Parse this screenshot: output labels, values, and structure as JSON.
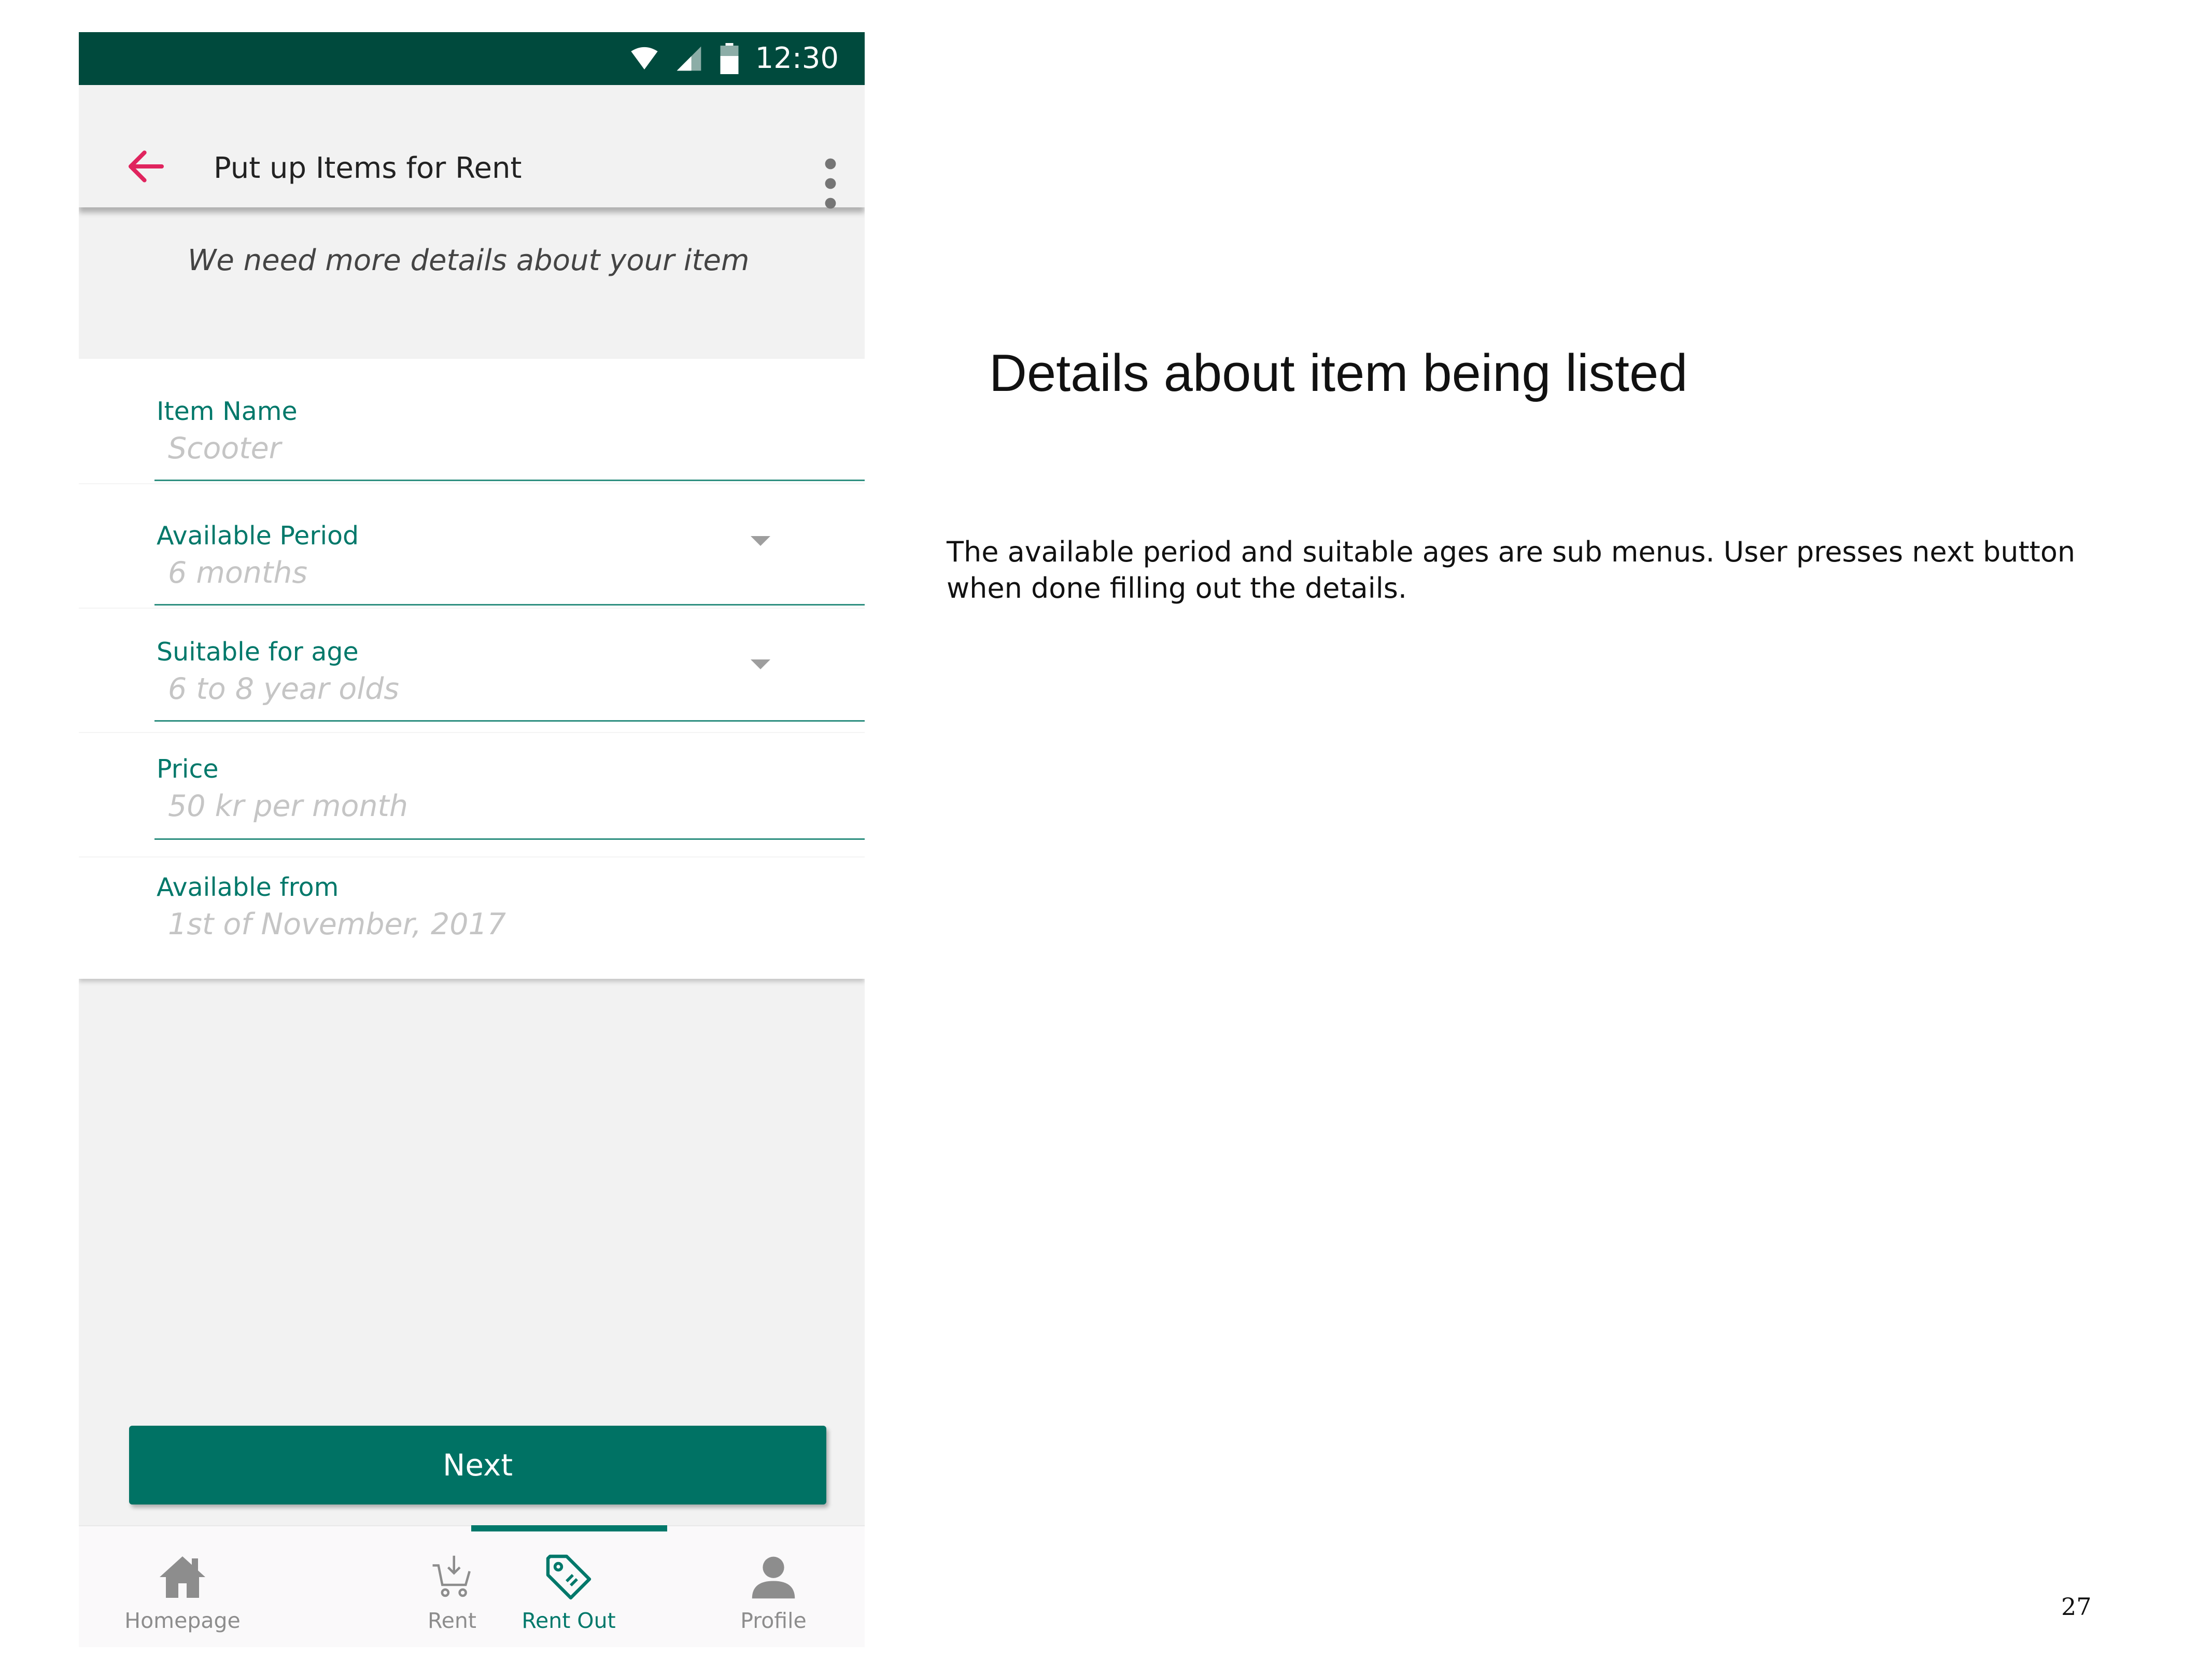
{
  "status_bar": {
    "time": "12:30",
    "icons": [
      "wifi-icon",
      "signal-icon",
      "battery-icon"
    ]
  },
  "app_bar": {
    "title": "Put up Items for Rent",
    "back_icon": "arrow-left-icon",
    "menu_icon": "more-vert-icon"
  },
  "subheader": {
    "message": "We need more details about your item"
  },
  "form": {
    "item_name": {
      "label": "Item Name",
      "placeholder": "Scooter"
    },
    "available_period": {
      "label": "Available Period",
      "placeholder": "6 months"
    },
    "suitable_age": {
      "label": "Suitable for age",
      "placeholder": "6 to 8 year olds"
    },
    "price": {
      "label": "Price",
      "placeholder": "50 kr per month"
    },
    "available_from": {
      "label": "Available from",
      "placeholder": "1st of November, 2017"
    }
  },
  "next_button": {
    "label": "Next"
  },
  "bottom_nav": {
    "active": "Rent Out",
    "items": [
      {
        "label": "Homepage",
        "icon": "home-icon"
      },
      {
        "label": "Rent",
        "icon": "cart-icon"
      },
      {
        "label": "Rent Out",
        "icon": "tag-icon"
      },
      {
        "label": "Profile",
        "icon": "person-icon"
      }
    ]
  },
  "annotation": {
    "heading": "Details about item being listed",
    "description": "The available period and suitable ages are sub menus. User presses next button when done filling out the details."
  },
  "page_number": "27",
  "colors": {
    "status_bar": "#004a3d",
    "accent": "#00786a",
    "button": "#007264",
    "back_arrow": "#e0245e"
  }
}
